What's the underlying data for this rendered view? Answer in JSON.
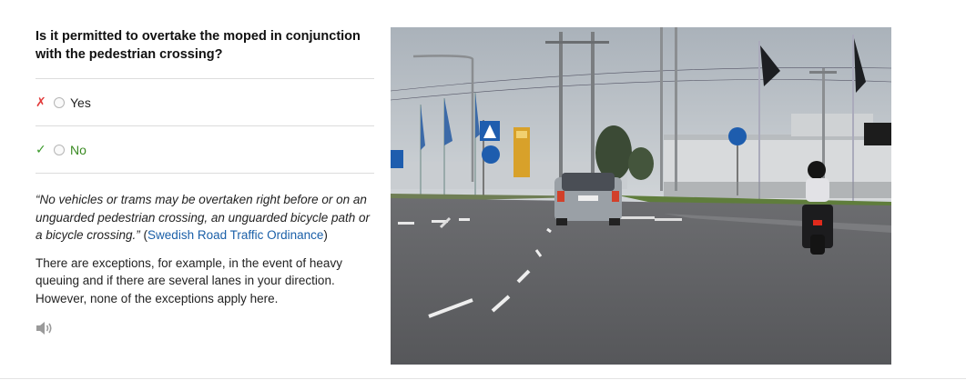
{
  "question": "Is it permitted to overtake the moped in conjunction with the pedestrian crossing?",
  "options": [
    {
      "mark": "✗",
      "label": "Yes",
      "status": "wrong"
    },
    {
      "mark": "✓",
      "label": "No",
      "status": "correct"
    }
  ],
  "quote": {
    "text": "“No vehicles or trams may be overtaken right before or on an unguarded pedestrian crossing, an unguarded bicycle path or a bicycle crossing.”",
    "paren_open": " (",
    "source": "Swedish Road Traffic Ordinance",
    "paren_close": ")"
  },
  "explanation": "There are exceptions, for example, in the event of heavy queuing and if there are several lanes in your direction. However, none of the exceptions apply here.",
  "colors": {
    "wrong": "#e23b3b",
    "correct": "#3a9a2a",
    "link": "#1a5fa8"
  },
  "icons": {
    "audio": "speaker-icon"
  }
}
